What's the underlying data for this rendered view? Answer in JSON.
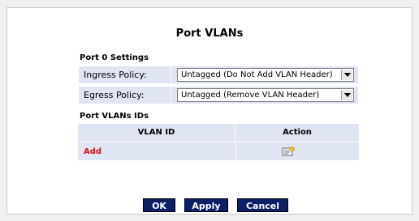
{
  "page": {
    "title": "Port VLANs"
  },
  "port_settings": {
    "section_title": "Port 0 Settings",
    "ingress": {
      "label": "Ingress Policy:",
      "value": "Untagged (Do Not Add VLAN Header)"
    },
    "egress": {
      "label": "Egress Policy:",
      "value": "Untagged (Remove VLAN Header)"
    }
  },
  "vlan_ids": {
    "section_title": "Port VLANs IDs",
    "columns": [
      "VLAN ID",
      "Action"
    ],
    "add_label": "Add",
    "action_icon": "add-edit-icon"
  },
  "buttons": {
    "ok": "OK",
    "apply": "Apply",
    "cancel": "Cancel"
  },
  "colors": {
    "header_bg": "#dfe5f2",
    "button_bg": "#0b1f66",
    "link_red": "#d21010"
  }
}
